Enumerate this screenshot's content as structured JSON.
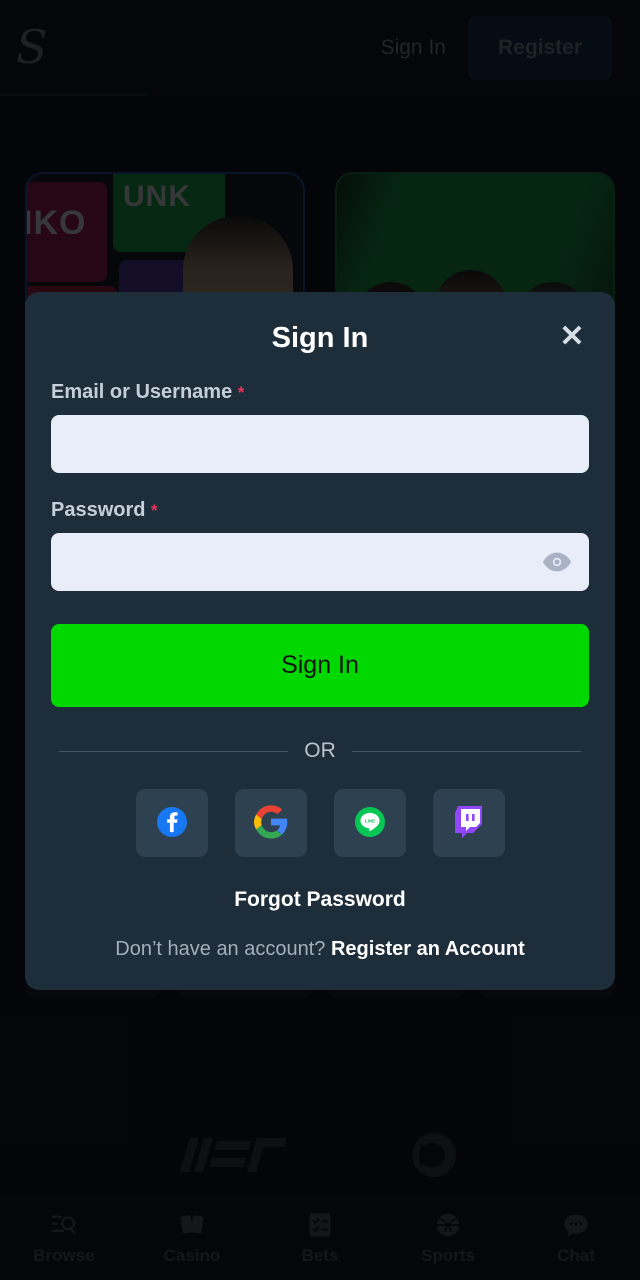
{
  "header": {
    "logo": "S",
    "logo_icon": "script-s-logo",
    "signin_label": "Sign In",
    "register_label": "Register",
    "register_bg": "#102840"
  },
  "background": {
    "promo_casino": {
      "tile_label_1": "IKO",
      "tile_label_2": "UNK"
    },
    "partners": [
      {
        "name": "iier-logo"
      },
      {
        "name": "play-circle-logo"
      }
    ]
  },
  "modal": {
    "title": "Sign In",
    "close_icon": "close-icon",
    "close_label": "✕",
    "fields": [
      {
        "label": "Email or Username",
        "required_mark": "*",
        "value": "",
        "placeholder": "",
        "type": "text"
      },
      {
        "label": "Password",
        "required_mark": "*",
        "value": "",
        "placeholder": "",
        "type": "password",
        "toggle_icon": "eye-icon"
      }
    ],
    "submit_label": "Sign In",
    "submit_color": "#00d800",
    "divider_text": "OR",
    "social": [
      {
        "name": "facebook",
        "icon": "facebook-icon",
        "color": "#1877f2"
      },
      {
        "name": "google",
        "icon": "google-icon",
        "color": "#ffffff"
      },
      {
        "name": "line",
        "icon": "line-icon",
        "color": "#06c755"
      },
      {
        "name": "twitch",
        "icon": "twitch-icon",
        "color": "#9146ff"
      }
    ],
    "forgot_label": "Forgot Password",
    "register_question": "Don’t have an account?",
    "register_link": "Register an Account"
  },
  "bottom_nav": [
    {
      "label": "Browse",
      "icon": "browse-search-icon"
    },
    {
      "label": "Casino",
      "icon": "playing-cards-icon"
    },
    {
      "label": "Bets",
      "icon": "checklist-icon"
    },
    {
      "label": "Sports",
      "icon": "basketball-icon"
    },
    {
      "label": "Chat",
      "icon": "chat-bubble-icon"
    }
  ]
}
